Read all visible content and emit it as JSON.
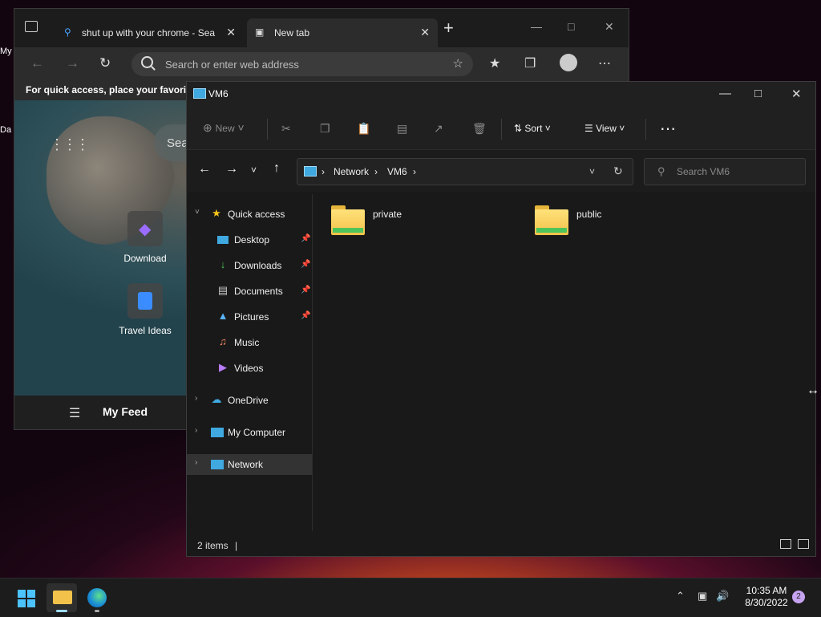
{
  "desktop": {
    "icon1_label": "My",
    "icon2_label": "Da"
  },
  "edge": {
    "tabs": [
      {
        "title": "shut up with your chrome - Sea"
      },
      {
        "title": "New tab"
      }
    ],
    "address_placeholder": "Search or enter web address",
    "favorites_hint": "For quick access, place your favorites here on the favorites bar.",
    "tiles": [
      {
        "label": "Download"
      },
      {
        "label": "Travel Ideas"
      }
    ],
    "ntp_search_prefix": "Sea",
    "feed_label": "My Feed"
  },
  "explorer": {
    "title": "VM6",
    "cmd": {
      "new": "New",
      "sort": "Sort",
      "view": "View"
    },
    "breadcrumb": [
      "Network",
      "VM6"
    ],
    "search_placeholder": "Search VM6",
    "nav": {
      "quick_access": "Quick access",
      "items": [
        {
          "label": "Desktop",
          "icon": "desktop-icon",
          "pinned": true
        },
        {
          "label": "Downloads",
          "icon": "downloads-icon",
          "pinned": true
        },
        {
          "label": "Documents",
          "icon": "documents-icon",
          "pinned": true
        },
        {
          "label": "Pictures",
          "icon": "pictures-icon",
          "pinned": true
        },
        {
          "label": "Music",
          "icon": "music-icon",
          "pinned": false
        },
        {
          "label": "Videos",
          "icon": "videos-icon",
          "pinned": false
        }
      ],
      "onedrive": "OneDrive",
      "my_computer": "My Computer",
      "network": "Network"
    },
    "folders": [
      {
        "name": "private"
      },
      {
        "name": "public"
      }
    ],
    "status": "2 items"
  },
  "taskbar": {
    "time": "10:35 AM",
    "date": "8/30/2022",
    "notification_count": "2",
    "accent": "#4cc2ff"
  }
}
